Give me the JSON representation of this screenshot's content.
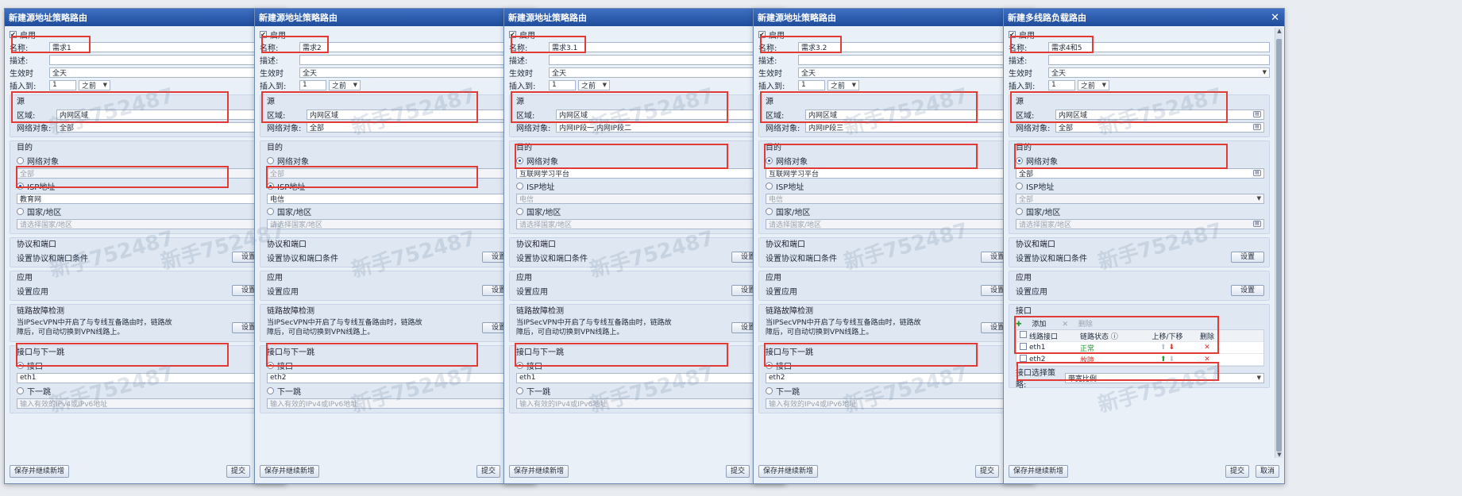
{
  "watermark": "新手752487",
  "common": {
    "enable_label": "启用",
    "name_label": "名称:",
    "desc_label": "描述:",
    "effective_label": "生效时",
    "insert_label": "插入到:",
    "insert_value": "1",
    "insert_position": "之前",
    "source_title": "源",
    "zone_label": "区域:",
    "netobj_label": "网络对象:",
    "dest_title": "目的",
    "dest_netobj": "网络对象",
    "dest_isp": "ISP地址",
    "dest_country": "国家/地区",
    "country_placeholder": "请选择国家/地区",
    "proto_title": "协议和端口",
    "proto_desc": "设置协议和端口条件",
    "app_title": "应用",
    "app_desc": "设置应用",
    "link_title": "链路故障检测",
    "link_desc": "当IPSecVPN中开启了与专线互备路由时，链路故障后，可自动切换到VPN线路上。",
    "set_btn": "设置",
    "iface_title": "接口与下一跳",
    "iface_opt": "接口",
    "nexthop_opt": "下一跳",
    "nexthop_placeholder": "输入有效的IPv4或IPv6地址",
    "save_new": "保存并继续新增",
    "submit": "提交",
    "cancel": "取消"
  },
  "dialogs": [
    {
      "title": "新建源地址策略路由",
      "name": "需求1",
      "effective": "全天",
      "zone": "内网区域",
      "netobj": "全部",
      "dest_mode": "isp",
      "dest_netobj_value": "全部",
      "isp_value": "教育网",
      "iface_value": "eth1"
    },
    {
      "title": "新建源地址策略路由",
      "name": "需求2",
      "effective": "全天",
      "zone": "内网区域",
      "netobj": "全部",
      "dest_mode": "isp",
      "dest_netobj_value": "全部",
      "isp_value": "电信",
      "iface_value": "eth2"
    },
    {
      "title": "新建源地址策略路由",
      "name": "需求3.1",
      "effective": "全天",
      "zone": "内网区域",
      "netobj": "内网IP段一,内网IP段二",
      "dest_mode": "netobj",
      "dest_netobj_value": "互联网学习平台",
      "isp_value": "电信",
      "iface_value": "eth1"
    },
    {
      "title": "新建源地址策略路由",
      "name": "需求3.2",
      "effective": "全天",
      "zone": "内网区域",
      "netobj": "内网IP段三",
      "dest_mode": "netobj",
      "dest_netobj_value": "互联网学习平台",
      "isp_value": "电信",
      "iface_value": "eth2"
    }
  ],
  "multi": {
    "title": "新建多线路负载路由",
    "name": "需求4和5",
    "effective": "全天",
    "zone": "内网区域",
    "netobj": "全部",
    "dest_netobj_value": "全部",
    "isp_value": "全部",
    "iface_section": "接口",
    "add": "添加",
    "delete": "删除",
    "headers": [
      "线路接口",
      "链路状态",
      "上移/下移",
      "删除"
    ],
    "rows": [
      {
        "iface": "eth1",
        "status": "正常",
        "status_color": "#1e9b2e"
      },
      {
        "iface": "eth2",
        "status": "故障",
        "status_color": "#e0342f"
      }
    ],
    "strategy_label": "接口选择策略:",
    "strategy_value": "带宽比例"
  }
}
